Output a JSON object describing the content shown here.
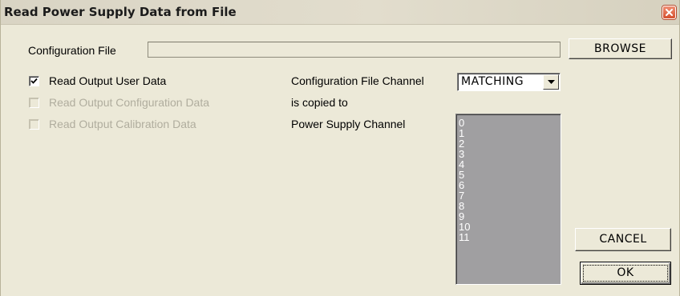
{
  "window": {
    "title": "Read Power Supply Data from File",
    "close_icon": "close-icon"
  },
  "config_file": {
    "label": "Configuration File",
    "value": "",
    "browse_label": "BROWSE"
  },
  "options": [
    {
      "label": "Read Output User Data",
      "checked": true,
      "enabled": true
    },
    {
      "label": "Read Output Configuration Data",
      "checked": false,
      "enabled": false
    },
    {
      "label": "Read Output Calibration Data",
      "checked": false,
      "enabled": false
    }
  ],
  "mapping": {
    "channel_label": "Configuration File Channel",
    "copied_label": "is copied to",
    "supply_label": "Power Supply Channel",
    "selected": "MATCHING",
    "channels": [
      "0",
      "1",
      "2",
      "3",
      "4",
      "5",
      "6",
      "7",
      "8",
      "9",
      "10",
      "11"
    ]
  },
  "actions": {
    "cancel_label": "CANCEL",
    "ok_label": "OK"
  }
}
